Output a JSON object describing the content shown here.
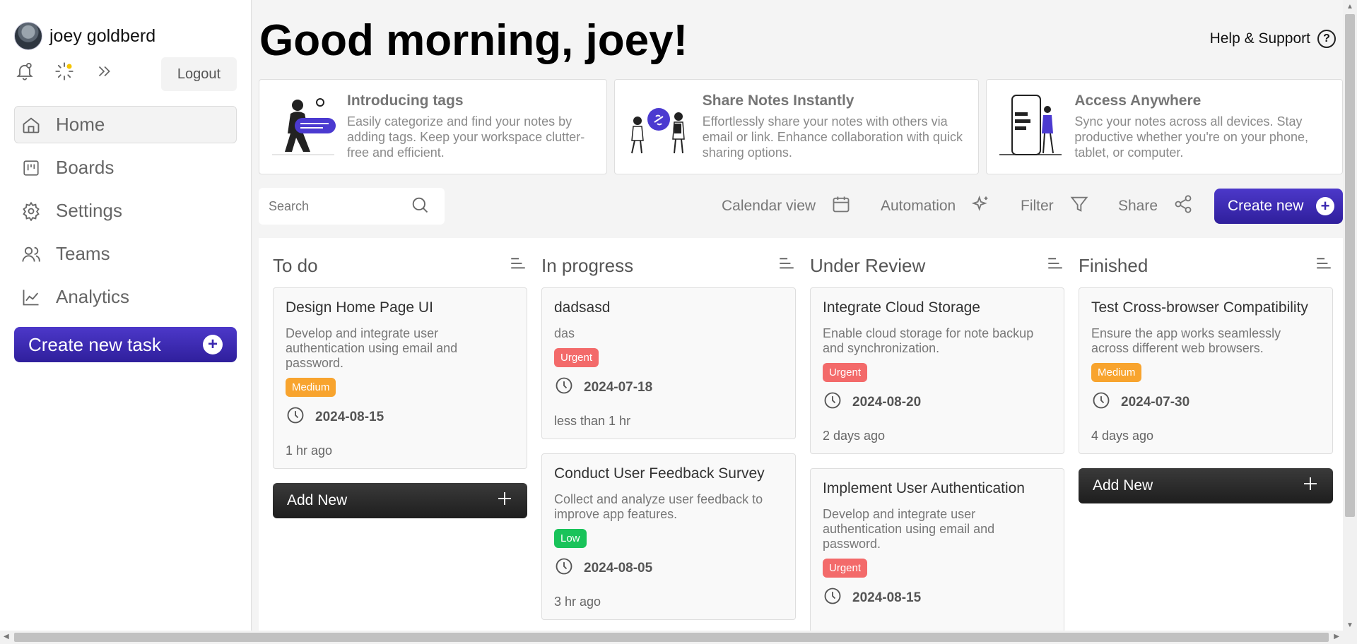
{
  "user": {
    "name": "joey goldberd"
  },
  "sidebar": {
    "logout_label": "Logout",
    "items": [
      {
        "label": "Home",
        "icon": "home-icon",
        "active": true
      },
      {
        "label": "Boards",
        "icon": "boards-icon",
        "active": false
      },
      {
        "label": "Settings",
        "icon": "gear-icon",
        "active": false
      },
      {
        "label": "Teams",
        "icon": "users-icon",
        "active": false
      },
      {
        "label": "Analytics",
        "icon": "analytics-icon",
        "active": false
      }
    ],
    "create_task_label": "Create new task"
  },
  "header": {
    "greeting": "Good morning, joey!",
    "help_label": "Help & Support"
  },
  "features": [
    {
      "title": "Introducing tags",
      "text": "Easily categorize and find your notes by adding tags. Keep your workspace clutter-free and efficient."
    },
    {
      "title": "Share Notes Instantly",
      "text": "Effortlessly share your notes with others via email or link. Enhance collaboration with quick sharing options."
    },
    {
      "title": "Access Anywhere",
      "text": "Sync your notes across all devices. Stay productive whether you're on your phone, tablet, or computer."
    }
  ],
  "toolbar": {
    "search_placeholder": "Search",
    "calendar_label": "Calendar view",
    "automation_label": "Automation",
    "filter_label": "Filter",
    "share_label": "Share",
    "create_new_label": "Create new"
  },
  "colors": {
    "accent": "#3a28b0",
    "urgent": "#f36a6a",
    "medium": "#f8a42e",
    "low": "#19c35a"
  },
  "columns": [
    {
      "title": "To do",
      "add_label": "Add New",
      "cards": [
        {
          "title": "Design Home Page UI",
          "desc": "Develop and integrate user authentication using email and password.",
          "priority": "Medium",
          "date": "2024-08-15",
          "ago": "1 hr ago"
        }
      ]
    },
    {
      "title": "In progress",
      "cards": [
        {
          "title": "dadsasd",
          "desc": "das",
          "priority": "Urgent",
          "date": "2024-07-18",
          "ago": "less than 1 hr"
        },
        {
          "title": "Conduct User Feedback Survey",
          "desc": "Collect and analyze user feedback to improve app features.",
          "priority": "Low",
          "date": "2024-08-05",
          "ago": "3 hr ago"
        }
      ]
    },
    {
      "title": "Under Review",
      "cards": [
        {
          "title": "Integrate Cloud Storage",
          "desc": "Enable cloud storage for note backup and synchronization.",
          "priority": "Urgent",
          "date": "2024-08-20",
          "ago": "2 days ago"
        },
        {
          "title": "Implement User Authentication",
          "desc": "Develop and integrate user authentication using email and password.",
          "priority": "Urgent",
          "date": "2024-08-15",
          "ago": ""
        }
      ]
    },
    {
      "title": "Finished",
      "add_label": "Add New",
      "cards": [
        {
          "title": "Test Cross-browser Compatibility",
          "desc": "Ensure the app works seamlessly across different web browsers.",
          "priority": "Medium",
          "date": "2024-07-30",
          "ago": "4 days ago"
        }
      ]
    }
  ]
}
